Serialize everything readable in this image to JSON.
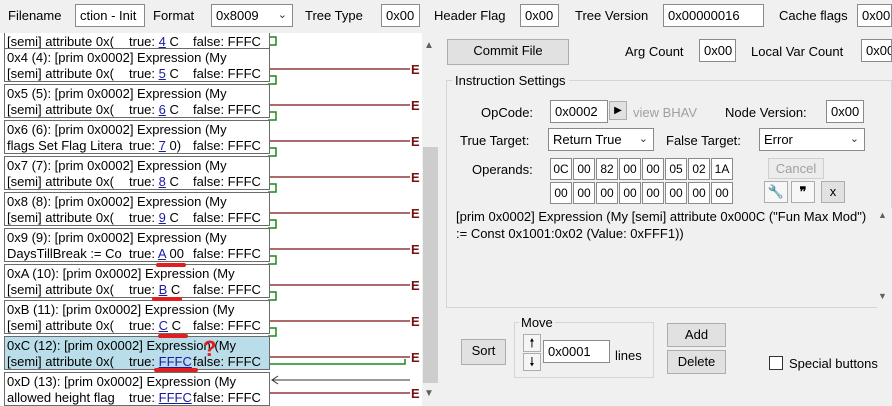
{
  "toolbar": {
    "filename_label": "Filename",
    "filename_value": "ction - Init",
    "format_label": "Format",
    "format_value": "0x8009",
    "tree_type_label": "Tree Type",
    "tree_type_value": "0x00",
    "header_flag_label": "Header Flag",
    "header_flag_value": "0x00",
    "tree_version_label": "Tree Version",
    "tree_version_value": "0x00000016",
    "cache_flags_label": "Cache flags",
    "cache_flags_value": "0x00"
  },
  "graph": {
    "top_partial": {
      "l2": "[semi] attribute 0x(",
      "true_text": "true: ",
      "true_val": "4",
      "true_rest": " C",
      "false_text": "false: FFFC"
    },
    "nodes": [
      {
        "l1": "0x4 (4): [prim 0x0002] Expression (My",
        "l2": "[semi] attribute 0x(",
        "true_text": "true: ",
        "true_val": "5",
        "true_rest": " C",
        "false_text": "false: FFFC",
        "emark": "E"
      },
      {
        "l1": "0x5 (5): [prim 0x0002] Expression (My",
        "l2": "[semi] attribute 0x(",
        "true_text": "true: ",
        "true_val": "6",
        "true_rest": " C",
        "false_text": "false: FFFC",
        "emark": "E"
      },
      {
        "l1": "0x6 (6): [prim 0x0002] Expression (My",
        "l2": "flags Set Flag Litera",
        "true_text": "true: ",
        "true_val": "7",
        "true_rest": " 0)",
        "false_text": "false: FFFC",
        "emark": "E"
      },
      {
        "l1": "0x7 (7): [prim 0x0002] Expression (My",
        "l2": "[semi] attribute 0x(",
        "true_text": "true: ",
        "true_val": "8",
        "true_rest": " C",
        "false_text": "false: FFFC",
        "emark": "E"
      },
      {
        "l1": "0x8 (8): [prim 0x0002] Expression (My",
        "l2": "[semi] attribute 0x(",
        "true_text": "true: ",
        "true_val": "9",
        "true_rest": " C",
        "false_text": "false: FFFC",
        "emark": "E"
      },
      {
        "l1": "0x9 (9): [prim 0x0002] Expression (My",
        "l2": "DaysTillBreak := Co",
        "true_text": "true: ",
        "true_val": "A",
        "true_rest": " 00",
        "false_text": "false: FFFC",
        "emark": "E"
      },
      {
        "l1": "0xA (10): [prim 0x0002] Expression (My",
        "l2": "[semi] attribute 0x(",
        "true_text": "true: ",
        "true_val": "B",
        "true_rest": " C",
        "false_text": "false: FFFC",
        "emark": "E"
      },
      {
        "l1": "0xB (11): [prim 0x0002] Expression (My",
        "l2": "[semi] attribute 0x(",
        "true_text": "true: ",
        "true_val": "C",
        "true_rest": " C",
        "false_text": "false: FFFC",
        "emark": "E"
      },
      {
        "l1": "0xC (12): [prim 0x0002] Expression (My",
        "l2": "[semi] attribute 0x(",
        "true_text": "true: ",
        "true_val": "FFFC",
        "true_rest": "",
        "false_text": "false: FFFC",
        "emark": "E"
      },
      {
        "l1": "0xD (13): [prim 0x0002] Expression (My",
        "l2": "allowed height flag",
        "true_text": "true: ",
        "true_val": "FFFC",
        "true_rest": "",
        "false_text": "false: FFFC",
        "emark": "E"
      }
    ],
    "annotation_mark": "?"
  },
  "panel": {
    "commit_button": "Commit File",
    "arg_count_label": "Arg Count",
    "arg_count_value": "0x00",
    "local_var_label": "Local Var Count",
    "local_var_value": "0x00",
    "group_title": "Instruction Settings",
    "opcode_label": "OpCode:",
    "opcode_value": "0x0002",
    "view_bhav": "view BHAV",
    "node_version_label": "Node Version:",
    "node_version_value": "0x00",
    "true_target_label": "True Target:",
    "true_target_value": "Return True",
    "false_target_label": "False Target:",
    "false_target_value": "Error",
    "operands_label": "Operands:",
    "operands_row1": [
      "0C",
      "00",
      "82",
      "00",
      "00",
      "05",
      "02",
      "1A"
    ],
    "operands_row2": [
      "00",
      "00",
      "00",
      "00",
      "00",
      "00",
      "00",
      "00"
    ],
    "cancel_button": "Cancel",
    "x_button": "x",
    "description": "[prim 0x0002] Expression (My [semi] attribute 0x000C (\"Fun Max Mod\") := Const 0x1001:0x02 (Value: 0xFFF1))",
    "sort_button": "Sort",
    "move_title": "Move",
    "move_value": "0x0001",
    "lines_label": "lines",
    "add_button": "Add",
    "delete_button": "Delete",
    "special_buttons_label": "Special buttons"
  },
  "colors": {
    "selected_node": "#b9dde9",
    "true_arrow": "#1a8a1a",
    "false_arrow": "#7a1010",
    "annotation": "#e02020"
  }
}
